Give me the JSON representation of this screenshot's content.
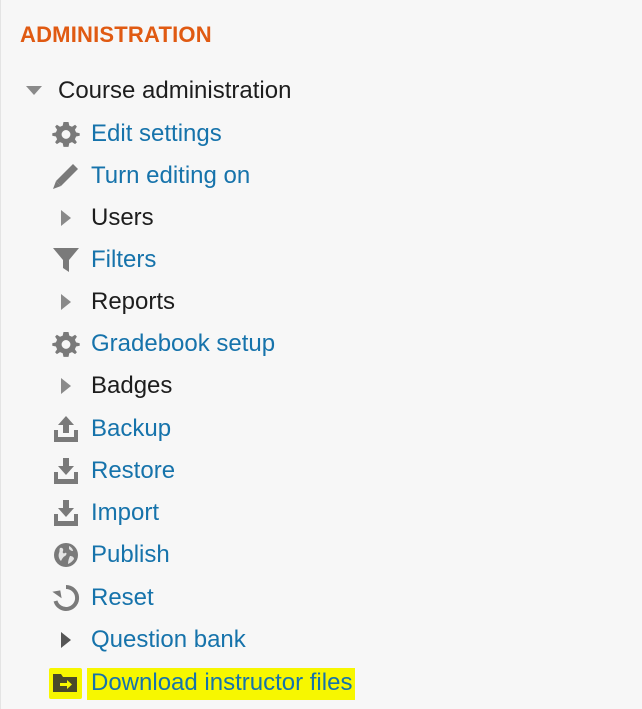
{
  "block": {
    "title": "ADMINISTRATION"
  },
  "course_admin": {
    "label": "Course administration",
    "expanded": true
  },
  "items": [
    {
      "label": "Edit settings",
      "icon": "gear-icon",
      "kind": "link"
    },
    {
      "label": "Turn editing on",
      "icon": "pencil-icon",
      "kind": "link"
    },
    {
      "label": "Users",
      "icon": "caret-right-icon",
      "kind": "category"
    },
    {
      "label": "Filters",
      "icon": "filter-icon",
      "kind": "link"
    },
    {
      "label": "Reports",
      "icon": "caret-right-icon",
      "kind": "category"
    },
    {
      "label": "Gradebook setup",
      "icon": "gear-icon",
      "kind": "link"
    },
    {
      "label": "Badges",
      "icon": "caret-right-icon",
      "kind": "category"
    },
    {
      "label": "Backup",
      "icon": "upload-icon",
      "kind": "link"
    },
    {
      "label": "Restore",
      "icon": "download-icon",
      "kind": "link"
    },
    {
      "label": "Import",
      "icon": "download-icon",
      "kind": "link"
    },
    {
      "label": "Publish",
      "icon": "globe-icon",
      "kind": "link"
    },
    {
      "label": "Reset",
      "icon": "refresh-icon",
      "kind": "link"
    },
    {
      "label": "Question bank",
      "icon": "caret-right-icon",
      "kind": "link-category"
    },
    {
      "label": "Download instructor files",
      "icon": "folder-arrow-icon",
      "kind": "link",
      "highlighted": true
    }
  ],
  "colors": {
    "title": "#e05a12",
    "link": "#1673ab",
    "text": "#1d1d1d",
    "icon": "#7a7a7a",
    "highlight": "#f7f700"
  }
}
